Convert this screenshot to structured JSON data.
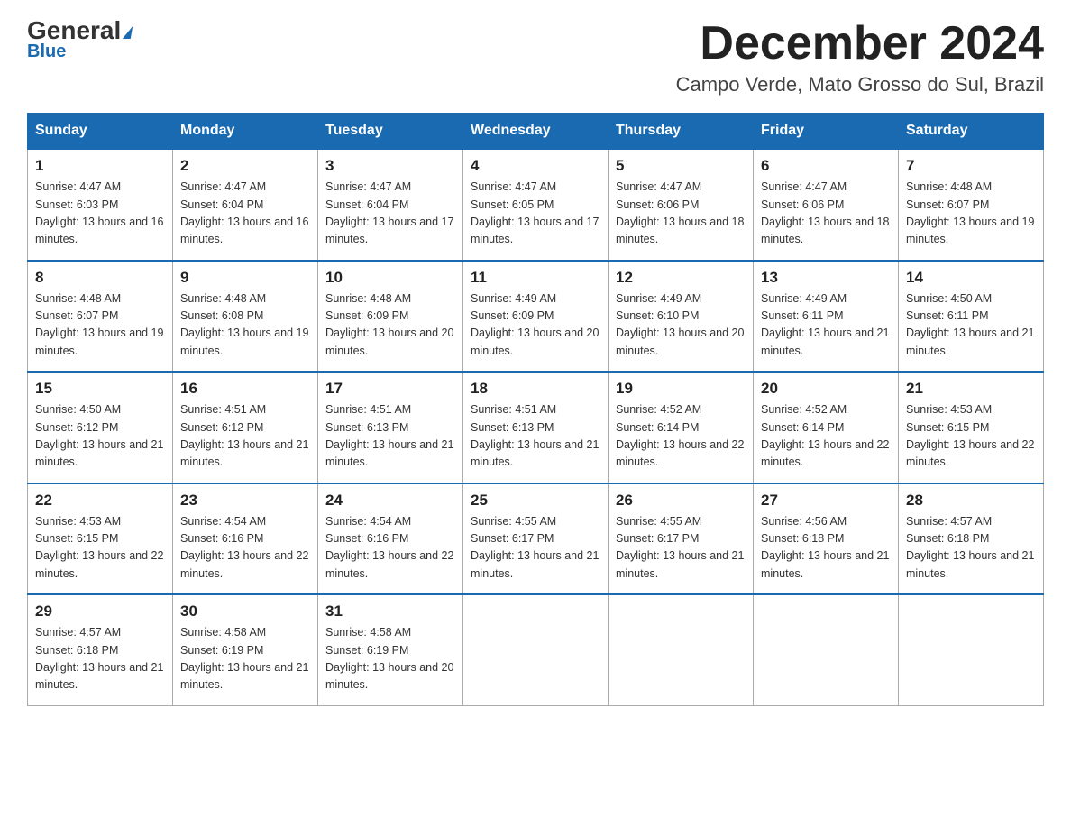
{
  "header": {
    "logo_general": "General",
    "logo_blue": "Blue",
    "month_title": "December 2024",
    "location": "Campo Verde, Mato Grosso do Sul, Brazil"
  },
  "weekdays": [
    "Sunday",
    "Monday",
    "Tuesday",
    "Wednesday",
    "Thursday",
    "Friday",
    "Saturday"
  ],
  "weeks": [
    [
      {
        "day": "1",
        "sunrise": "4:47 AM",
        "sunset": "6:03 PM",
        "daylight": "13 hours and 16 minutes."
      },
      {
        "day": "2",
        "sunrise": "4:47 AM",
        "sunset": "6:04 PM",
        "daylight": "13 hours and 16 minutes."
      },
      {
        "day": "3",
        "sunrise": "4:47 AM",
        "sunset": "6:04 PM",
        "daylight": "13 hours and 17 minutes."
      },
      {
        "day": "4",
        "sunrise": "4:47 AM",
        "sunset": "6:05 PM",
        "daylight": "13 hours and 17 minutes."
      },
      {
        "day": "5",
        "sunrise": "4:47 AM",
        "sunset": "6:06 PM",
        "daylight": "13 hours and 18 minutes."
      },
      {
        "day": "6",
        "sunrise": "4:47 AM",
        "sunset": "6:06 PM",
        "daylight": "13 hours and 18 minutes."
      },
      {
        "day": "7",
        "sunrise": "4:48 AM",
        "sunset": "6:07 PM",
        "daylight": "13 hours and 19 minutes."
      }
    ],
    [
      {
        "day": "8",
        "sunrise": "4:48 AM",
        "sunset": "6:07 PM",
        "daylight": "13 hours and 19 minutes."
      },
      {
        "day": "9",
        "sunrise": "4:48 AM",
        "sunset": "6:08 PM",
        "daylight": "13 hours and 19 minutes."
      },
      {
        "day": "10",
        "sunrise": "4:48 AM",
        "sunset": "6:09 PM",
        "daylight": "13 hours and 20 minutes."
      },
      {
        "day": "11",
        "sunrise": "4:49 AM",
        "sunset": "6:09 PM",
        "daylight": "13 hours and 20 minutes."
      },
      {
        "day": "12",
        "sunrise": "4:49 AM",
        "sunset": "6:10 PM",
        "daylight": "13 hours and 20 minutes."
      },
      {
        "day": "13",
        "sunrise": "4:49 AM",
        "sunset": "6:11 PM",
        "daylight": "13 hours and 21 minutes."
      },
      {
        "day": "14",
        "sunrise": "4:50 AM",
        "sunset": "6:11 PM",
        "daylight": "13 hours and 21 minutes."
      }
    ],
    [
      {
        "day": "15",
        "sunrise": "4:50 AM",
        "sunset": "6:12 PM",
        "daylight": "13 hours and 21 minutes."
      },
      {
        "day": "16",
        "sunrise": "4:51 AM",
        "sunset": "6:12 PM",
        "daylight": "13 hours and 21 minutes."
      },
      {
        "day": "17",
        "sunrise": "4:51 AM",
        "sunset": "6:13 PM",
        "daylight": "13 hours and 21 minutes."
      },
      {
        "day": "18",
        "sunrise": "4:51 AM",
        "sunset": "6:13 PM",
        "daylight": "13 hours and 21 minutes."
      },
      {
        "day": "19",
        "sunrise": "4:52 AM",
        "sunset": "6:14 PM",
        "daylight": "13 hours and 22 minutes."
      },
      {
        "day": "20",
        "sunrise": "4:52 AM",
        "sunset": "6:14 PM",
        "daylight": "13 hours and 22 minutes."
      },
      {
        "day": "21",
        "sunrise": "4:53 AM",
        "sunset": "6:15 PM",
        "daylight": "13 hours and 22 minutes."
      }
    ],
    [
      {
        "day": "22",
        "sunrise": "4:53 AM",
        "sunset": "6:15 PM",
        "daylight": "13 hours and 22 minutes."
      },
      {
        "day": "23",
        "sunrise": "4:54 AM",
        "sunset": "6:16 PM",
        "daylight": "13 hours and 22 minutes."
      },
      {
        "day": "24",
        "sunrise": "4:54 AM",
        "sunset": "6:16 PM",
        "daylight": "13 hours and 22 minutes."
      },
      {
        "day": "25",
        "sunrise": "4:55 AM",
        "sunset": "6:17 PM",
        "daylight": "13 hours and 21 minutes."
      },
      {
        "day": "26",
        "sunrise": "4:55 AM",
        "sunset": "6:17 PM",
        "daylight": "13 hours and 21 minutes."
      },
      {
        "day": "27",
        "sunrise": "4:56 AM",
        "sunset": "6:18 PM",
        "daylight": "13 hours and 21 minutes."
      },
      {
        "day": "28",
        "sunrise": "4:57 AM",
        "sunset": "6:18 PM",
        "daylight": "13 hours and 21 minutes."
      }
    ],
    [
      {
        "day": "29",
        "sunrise": "4:57 AM",
        "sunset": "6:18 PM",
        "daylight": "13 hours and 21 minutes."
      },
      {
        "day": "30",
        "sunrise": "4:58 AM",
        "sunset": "6:19 PM",
        "daylight": "13 hours and 21 minutes."
      },
      {
        "day": "31",
        "sunrise": "4:58 AM",
        "sunset": "6:19 PM",
        "daylight": "13 hours and 20 minutes."
      },
      null,
      null,
      null,
      null
    ]
  ]
}
